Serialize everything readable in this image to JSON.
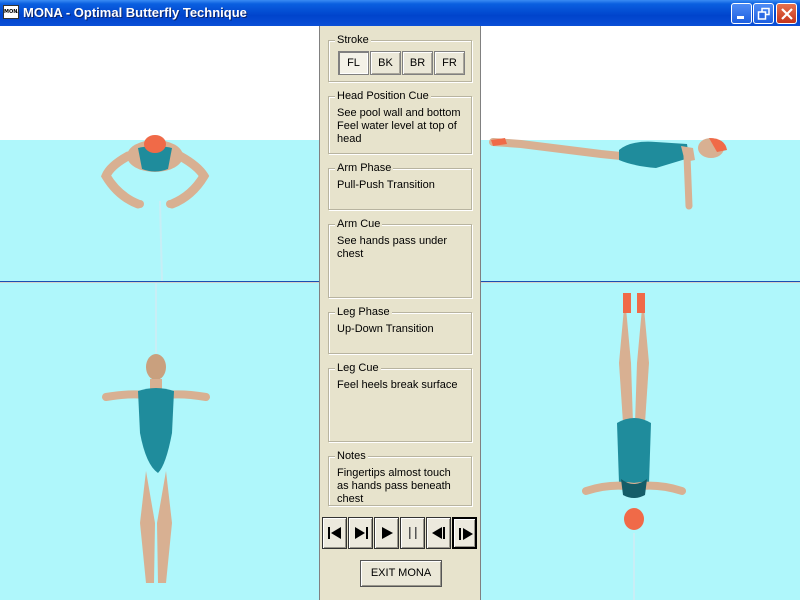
{
  "window": {
    "icon_text": "MONA",
    "title": "MONA - Optimal Butterfly Technique"
  },
  "colors": {
    "water": "#aff7fb",
    "panel": "#e7e3cc",
    "swimsuit": "#1f8c9c",
    "skin": "#e4bfa0",
    "cap": "#f06a48"
  },
  "stroke": {
    "label": "Stroke",
    "buttons": [
      "FL",
      "BK",
      "BR",
      "FR"
    ],
    "selected": "FL"
  },
  "head_position_cue": {
    "label": "Head Position Cue",
    "text": "See pool wall and bottom Feel water level at top of head"
  },
  "arm_phase": {
    "label": "Arm Phase",
    "text": "Pull-Push Transition"
  },
  "arm_cue": {
    "label": "Arm Cue",
    "text": "See hands pass under chest"
  },
  "leg_phase": {
    "label": "Leg Phase",
    "text": "Up-Down Transition"
  },
  "leg_cue": {
    "label": "Leg Cue",
    "text": "Feel heels break surface"
  },
  "notes": {
    "label": "Notes",
    "text": "Fingertips almost touch as hands pass beneath chest"
  },
  "transport": {
    "icons": [
      "skip-to-start-icon",
      "step-back-icon",
      "play-icon",
      "pause-icon",
      "step-back-frame-icon",
      "step-forward-icon"
    ]
  },
  "exit_label": "EXIT MONA"
}
